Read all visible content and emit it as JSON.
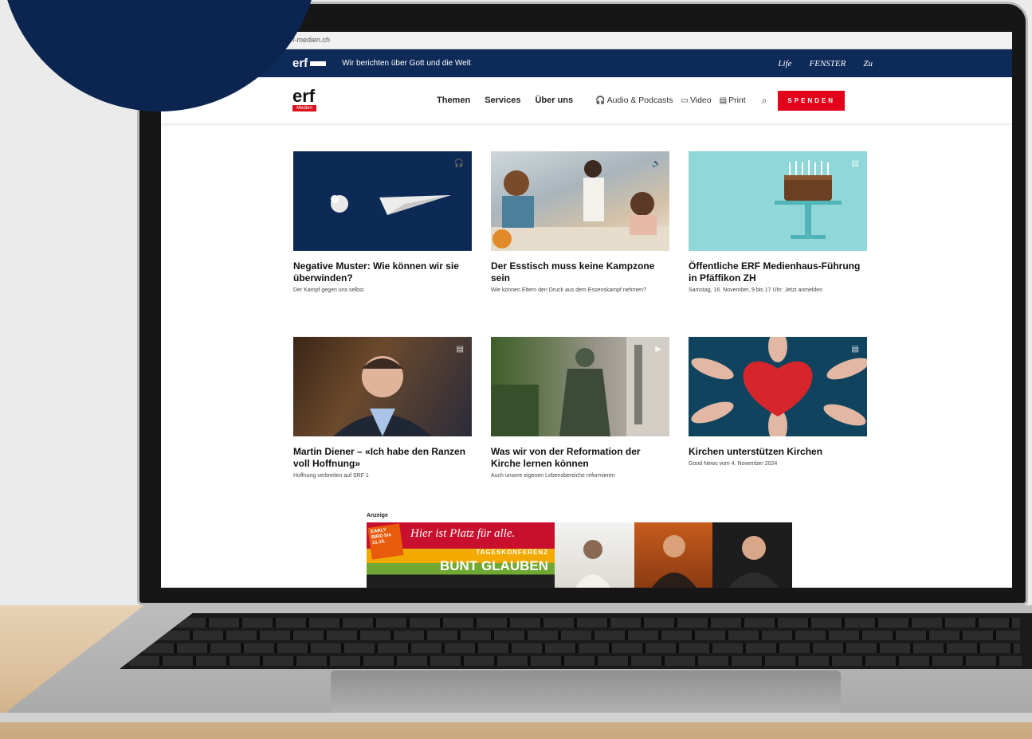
{
  "browser": {
    "url": "https://erf-medien.ch"
  },
  "topband": {
    "logo": "erf",
    "tagline": "Wir berichten über Gott und die Welt",
    "partners": [
      "Life",
      "FENSTER",
      "Zu"
    ]
  },
  "nav": {
    "logo_word": "erf",
    "logo_sub": "Medien",
    "items": [
      "Themen",
      "Services",
      "Über uns"
    ],
    "media": [
      "Audio & Podcasts",
      "Video",
      "Print"
    ],
    "donate": "SPENDEN"
  },
  "cards": [
    {
      "title": "Negative Muster: Wie können wir sie überwinden?",
      "subtitle": "Der Kampf gegen uns selbst",
      "badge": "headphones-icon"
    },
    {
      "title": "Der Esstisch muss keine Kampzone sein",
      "subtitle": "Wie können Eltern den Druck aus dem Essenskampf nehmen?",
      "badge": "speaker-icon"
    },
    {
      "title": "Öffentliche ERF Medienhaus-Führung in Pfäffikon ZH",
      "subtitle": "Samstag, 16. November, 9 bis 17 Uhr: Jetzt anmelden",
      "badge": "document-icon"
    },
    {
      "title": "Martin Diener – «Ich habe den Ranzen voll Hoffnung»",
      "subtitle": "Hoffnung verbreiten auf SRF 1",
      "badge": "document-icon"
    },
    {
      "title": "Was wir von der Reformation der Kirche lernen können",
      "subtitle": "Auch unsere eigenen Lebensbereiche reformieren",
      "badge": "play-icon"
    },
    {
      "title": "Kirchen unterstützen Kirchen",
      "subtitle": "Good News vom 4. November 2024",
      "badge": "document-icon"
    }
  ],
  "ad": {
    "label": "Anzeige",
    "early": "EARLY BIRD bis 31.10.",
    "slogan": "Hier ist Platz für alle.",
    "conference": "TAGESKONFERENZ",
    "title": "BUNT GLAUBEN"
  }
}
